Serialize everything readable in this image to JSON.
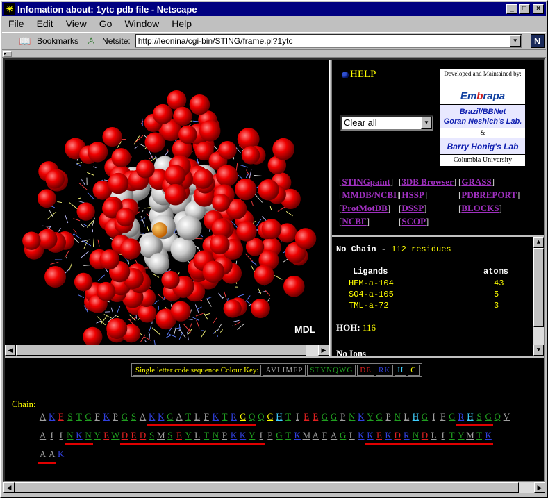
{
  "window": {
    "title": "Infomation about: 1ytc pdb file - Netscape",
    "buttons": [
      "_",
      "□",
      "×"
    ]
  },
  "menu": [
    "File",
    "Edit",
    "View",
    "Go",
    "Window",
    "Help"
  ],
  "location_bar": {
    "bookmarks_label": "Bookmarks",
    "netsite_label": "Netsite:",
    "url": "http://leonina/cgi-bin/STING/frame.pl?1ytc"
  },
  "molecule_view": {
    "logo": "MDL"
  },
  "side_panel": {
    "help_label": "HELP",
    "select_value": "Clear all",
    "credits": {
      "developed": "Developed and Maintained by:",
      "embrapa_pre": "Em",
      "embrapa_mid": "b",
      "embrapa_post": "rapa",
      "brazil_line1": "Brazil/BBNet",
      "brazil_line2": "Goran Neshich's Lab.",
      "amp": "&",
      "barry": "Barry Honig's Lab",
      "columbia": "Columbia University"
    },
    "links": [
      {
        "label": "STINGpaint"
      },
      {
        "label": "3DB Browser"
      },
      {
        "label": "GRASS"
      },
      {
        "label": "MMDB/NCBI"
      },
      {
        "label": "HSSP"
      },
      {
        "label": "PDBREPORT"
      },
      {
        "label": "ProtMotDB"
      },
      {
        "label": "DSSP"
      },
      {
        "label": "BLOCKS"
      },
      {
        "label": "NCBF"
      },
      {
        "label": "SCOP"
      }
    ]
  },
  "info_panel": {
    "chain_label": "No Chain -",
    "residues": "112 residues",
    "ligands_header": "Ligands",
    "atoms_header": "atoms",
    "ligands": [
      {
        "name": "HEM-a-104",
        "atoms": "43"
      },
      {
        "name": "SO4-a-105",
        "atoms": "5"
      },
      {
        "name": "TML-a-72",
        "atoms": "3"
      }
    ],
    "hoh_label": "HOH:",
    "hoh_value": "116",
    "ions_label": "No Ions"
  },
  "sequence_panel": {
    "key_label": "Single letter code sequence Colour Key:",
    "key_groups": [
      {
        "text": "AVLIMFP",
        "color": "#a0a0a0"
      },
      {
        "text": "STYNQWG",
        "color": "#20a020"
      },
      {
        "text": "DE",
        "color": "#e02020"
      },
      {
        "text": "RK",
        "color": "#3040e0"
      },
      {
        "text": "H",
        "color": "#40d0ff"
      },
      {
        "text": "C",
        "color": "#ffff00"
      }
    ],
    "chain_label": "Chain:",
    "colors": {
      "A": "#a0a0a0",
      "V": "#a0a0a0",
      "L": "#a0a0a0",
      "I": "#a0a0a0",
      "M": "#a0a0a0",
      "F": "#a0a0a0",
      "P": "#a0a0a0",
      "S": "#20a020",
      "T": "#20a020",
      "Y": "#20a020",
      "N": "#20a020",
      "Q": "#20a020",
      "W": "#20a020",
      "G": "#20a020",
      "D": "#e02020",
      "E": "#e02020",
      "R": "#3040e0",
      "K": "#3040e0",
      "H": "#40d0ff",
      "C": "#ffff00"
    },
    "lines": [
      {
        "seq": "AKESTGFKPGSAKKGATLFKTRCQQCHTIEEGGPNKYGPNLHGIFGRHSGQV",
        "ss": "000000000000111111111111000000000000000000000011110000"
      },
      {
        "seq": "AIINKNYEWDEDSMSEYLTNPKKYIPGTKMAFAGLKKEKDRNDLITYMTK",
        "ss": "00011100011111111111111110000000000011111111111111"
      },
      {
        "seq": "AAK",
        "ss": "110"
      }
    ]
  }
}
